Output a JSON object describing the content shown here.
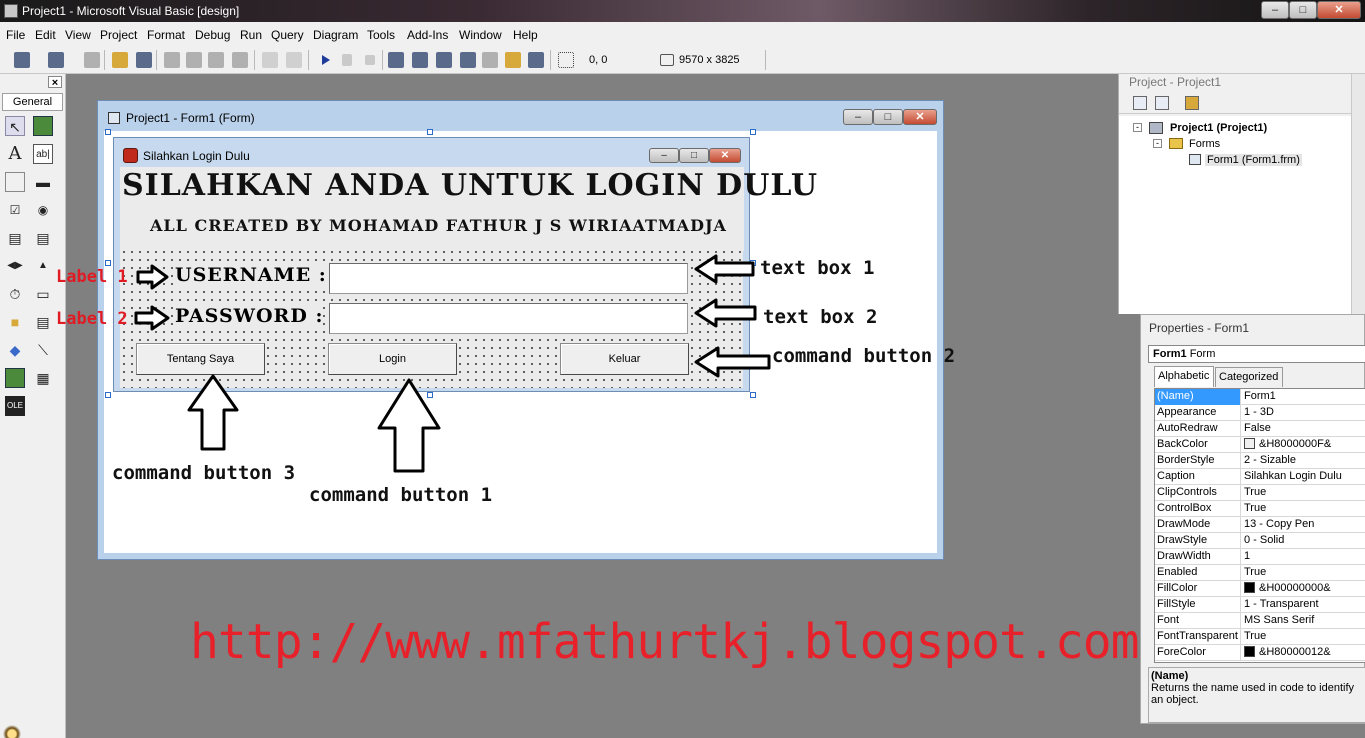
{
  "window": {
    "title": "Project1 - Microsoft Visual Basic [design]"
  },
  "menu": [
    "File",
    "Edit",
    "View",
    "Project",
    "Format",
    "Debug",
    "Run",
    "Query",
    "Diagram",
    "Tools",
    "Add-Ins",
    "Window",
    "Help"
  ],
  "toolbar": {
    "position": "0, 0",
    "size": "9570 x 3825"
  },
  "toolbox": {
    "tab_label": "General",
    "close": "×"
  },
  "form_window": {
    "title": "Project1 - Form1 (Form)"
  },
  "login_form": {
    "caption": "Silahkan Login Dulu",
    "heading": "SILAHKAN ANDA UNTUK LOGIN DULU",
    "subheading": "ALL CREATED BY MOHAMAD FATHUR J S WIRIAATMADJA",
    "username_label": "USERNAME :",
    "password_label": "PASSWORD :",
    "buttons": {
      "about": "Tentang Saya",
      "login": "Login",
      "exit": "Keluar"
    }
  },
  "annotations": {
    "label1": "Label 1",
    "label2": "Label 2",
    "textbox1": "text box 1",
    "textbox2": "text box 2",
    "cmd2": "command button 2",
    "cmd3": "command button 3",
    "cmd1": "command button 1",
    "url": "http://www.mfathurtkj.blogspot.com"
  },
  "project_explorer": {
    "title": "Project - Project1",
    "root": "Project1 (Project1)",
    "folder": "Forms",
    "item": "Form1 (Form1.frm)"
  },
  "properties": {
    "title": "Properties - Form1",
    "object_name": "Form1",
    "object_type": "Form",
    "tabs": [
      "Alphabetic",
      "Categorized"
    ],
    "rows": [
      {
        "name": "(Name)",
        "value": "Form1"
      },
      {
        "name": "Appearance",
        "value": "1 - 3D"
      },
      {
        "name": "AutoRedraw",
        "value": "False"
      },
      {
        "name": "BackColor",
        "value": "&H8000000F&"
      },
      {
        "name": "BorderStyle",
        "value": "2 - Sizable"
      },
      {
        "name": "Caption",
        "value": "Silahkan Login Dulu"
      },
      {
        "name": "ClipControls",
        "value": "True"
      },
      {
        "name": "ControlBox",
        "value": "True"
      },
      {
        "name": "DrawMode",
        "value": "13 - Copy Pen"
      },
      {
        "name": "DrawStyle",
        "value": "0 - Solid"
      },
      {
        "name": "DrawWidth",
        "value": "1"
      },
      {
        "name": "Enabled",
        "value": "True"
      },
      {
        "name": "FillColor",
        "value": "&H00000000&"
      },
      {
        "name": "FillStyle",
        "value": "1 - Transparent"
      },
      {
        "name": "Font",
        "value": "MS Sans Serif"
      },
      {
        "name": "FontTransparent",
        "value": "True"
      },
      {
        "name": "ForeColor",
        "value": "&H80000012&"
      }
    ],
    "swatches": {
      "BackColor": "#f0f0f0",
      "FillColor": "#000000",
      "ForeColor": "#000000"
    },
    "desc_title": "(Name)",
    "desc_text": "Returns the name used in code to identify an object."
  },
  "colors": {
    "url_red": "#e8202a",
    "label_red": "#e01b24",
    "selection": "#3399ff"
  }
}
